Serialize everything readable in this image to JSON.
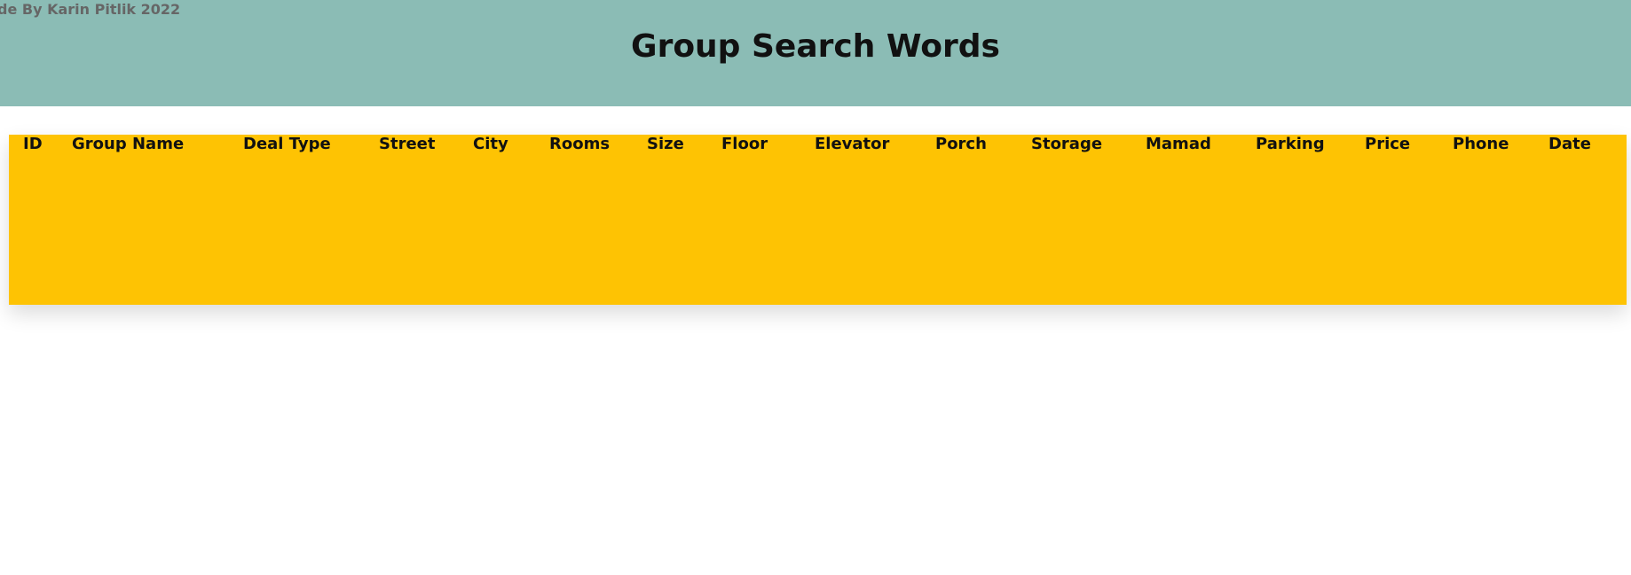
{
  "credit": "de By Karin Pitlik 2022",
  "title": "Group Search Words",
  "colors": {
    "header_bg": "#8bbcb5",
    "table_header_bg": "#fec303",
    "credit_text": "#666666"
  },
  "table": {
    "columns": [
      "ID",
      "Group Name",
      "Deal Type",
      "Street",
      "City",
      "Rooms",
      "Size",
      "Floor",
      "Elevator",
      "Porch",
      "Storage",
      "Mamad",
      "Parking",
      "Price",
      "Phone",
      "Date"
    ],
    "rows": []
  }
}
